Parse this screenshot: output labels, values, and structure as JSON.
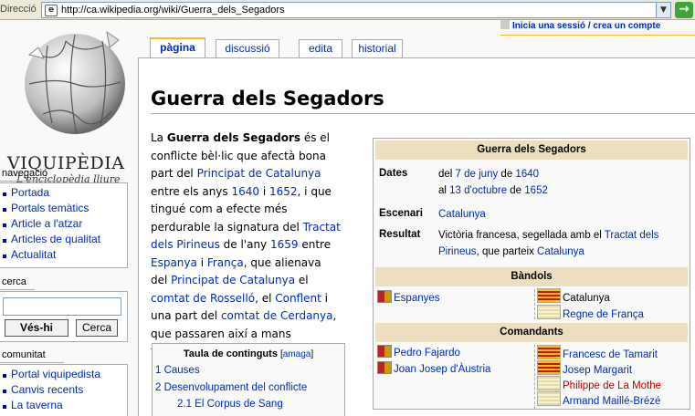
{
  "browser": {
    "address_label": "Direcció",
    "url": "http://ca.wikipedia.org/wiki/Guerra_dels_Segadors",
    "go_label": "→"
  },
  "logo": {
    "title": "VIQUIPÈDIA",
    "subtitle": "L'enciclopèdia lliure"
  },
  "personal": {
    "login_text": "Inicia una sessió / crea un compte"
  },
  "tabs": [
    {
      "label": "pàgina"
    },
    {
      "label": "discussió"
    },
    {
      "label": "edita"
    },
    {
      "label": "historial"
    }
  ],
  "sidebar": {
    "navigation": {
      "title": "navegació",
      "items": [
        "Portada",
        "Portals temàtics",
        "Article a l'atzar",
        "Articles de qualitat",
        "Actualitat"
      ]
    },
    "search": {
      "title": "cerca",
      "go_label": "Vés-hi",
      "search_label": "Cerca"
    },
    "community": {
      "title": "comunitat",
      "items": [
        "Portal viquipedista",
        "Canvis recents",
        "La taverna"
      ]
    }
  },
  "article": {
    "title": "Guerra dels Segadors",
    "para": [
      {
        "t": "La "
      },
      {
        "t": "Guerra dels Segadors",
        "b": true
      },
      {
        "t": " és el conflicte bèl·lic que afectà bona part del "
      },
      {
        "t": "Principat de Catalunya",
        "a": true
      },
      {
        "t": " entre els anys "
      },
      {
        "t": "1640",
        "a": true
      },
      {
        "t": " i "
      },
      {
        "t": "1652",
        "a": true
      },
      {
        "t": ", i que tingué com a efecte més perdurable la signatura del "
      },
      {
        "t": "Tractat dels Pirineus",
        "a": true
      },
      {
        "t": " de l'any "
      },
      {
        "t": "1659",
        "a": true
      },
      {
        "t": " entre "
      },
      {
        "t": "Espanya",
        "a": true
      },
      {
        "t": " i "
      },
      {
        "t": "França",
        "a": true
      },
      {
        "t": ", que alienava del "
      },
      {
        "t": "Principat de Catalunya",
        "a": true
      },
      {
        "t": " el "
      },
      {
        "t": "comtat de Rosselló",
        "a": true
      },
      {
        "t": ", el "
      },
      {
        "t": "Conflent",
        "a": true
      },
      {
        "t": " i una part del "
      },
      {
        "t": "comtat de Cerdanya",
        "a": true
      },
      {
        "t": ", que passaren així a mans franceses."
      }
    ]
  },
  "toc": {
    "title": "Taula de continguts",
    "toggle_open": "[",
    "toggle_label": "amaga",
    "toggle_close": "]",
    "items": [
      "1 Causes",
      "2 Desenvolupament del conflicte",
      "2.1 El Corpus de Sang"
    ]
  },
  "infobox": {
    "title": "Guerra dels Segadors",
    "dates_label": "Dates",
    "dates_line1": {
      "pre": "del ",
      "day": "7 de juny",
      "mid": " de ",
      "year": "1640"
    },
    "dates_line2": {
      "pre": "al ",
      "day": "13 d'octubre",
      "mid": " de ",
      "year": "1652"
    },
    "scenario_label": "Escenari",
    "scenario_value": "Catalunya",
    "result_label": "Resultat",
    "result_pre": "Victòria francesa, segellada amb el ",
    "result_link": "Tractat dels Pirineus",
    "result_mid": ", que parteix ",
    "result_link2": "Catalunya",
    "sides_title": "Bàndols",
    "side_left": "Espanyes",
    "side_right1": "Catalunya",
    "side_right2": "Regne de França",
    "commanders_title": "Comandants",
    "cmd_left": [
      "Pedro Fajardo",
      "Joan Josep d'Àustria"
    ],
    "cmd_right": [
      "Francesc de Tamarit",
      "Josep Margarit",
      "Philippe de La Mothe",
      "Armand Maillé-Brézé"
    ]
  }
}
